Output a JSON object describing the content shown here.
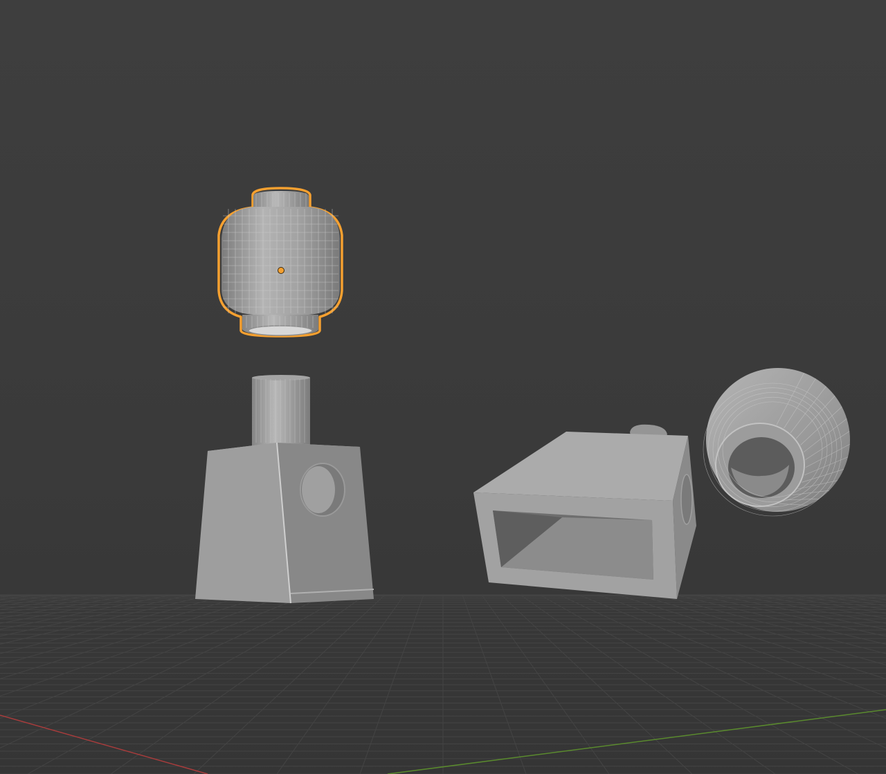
{
  "viewport": {
    "background_color": "#3a3a3a",
    "grid_color": "#444444",
    "x_axis_color": "#a83c3c",
    "y_axis_color": "#5a8a2e",
    "selection_color": "#f5a030",
    "mesh_color": "#9a9a9a",
    "wire_color": "#c4c4c4"
  },
  "objects": [
    {
      "name": "head",
      "icon": "cylinder-head-mesh",
      "selected": true
    },
    {
      "name": "torso",
      "icon": "torso-mesh",
      "selected": false
    },
    {
      "name": "torso-rotated",
      "icon": "torso-mesh",
      "selected": false
    },
    {
      "name": "head-rotated",
      "icon": "cylinder-head-mesh",
      "selected": false
    }
  ]
}
